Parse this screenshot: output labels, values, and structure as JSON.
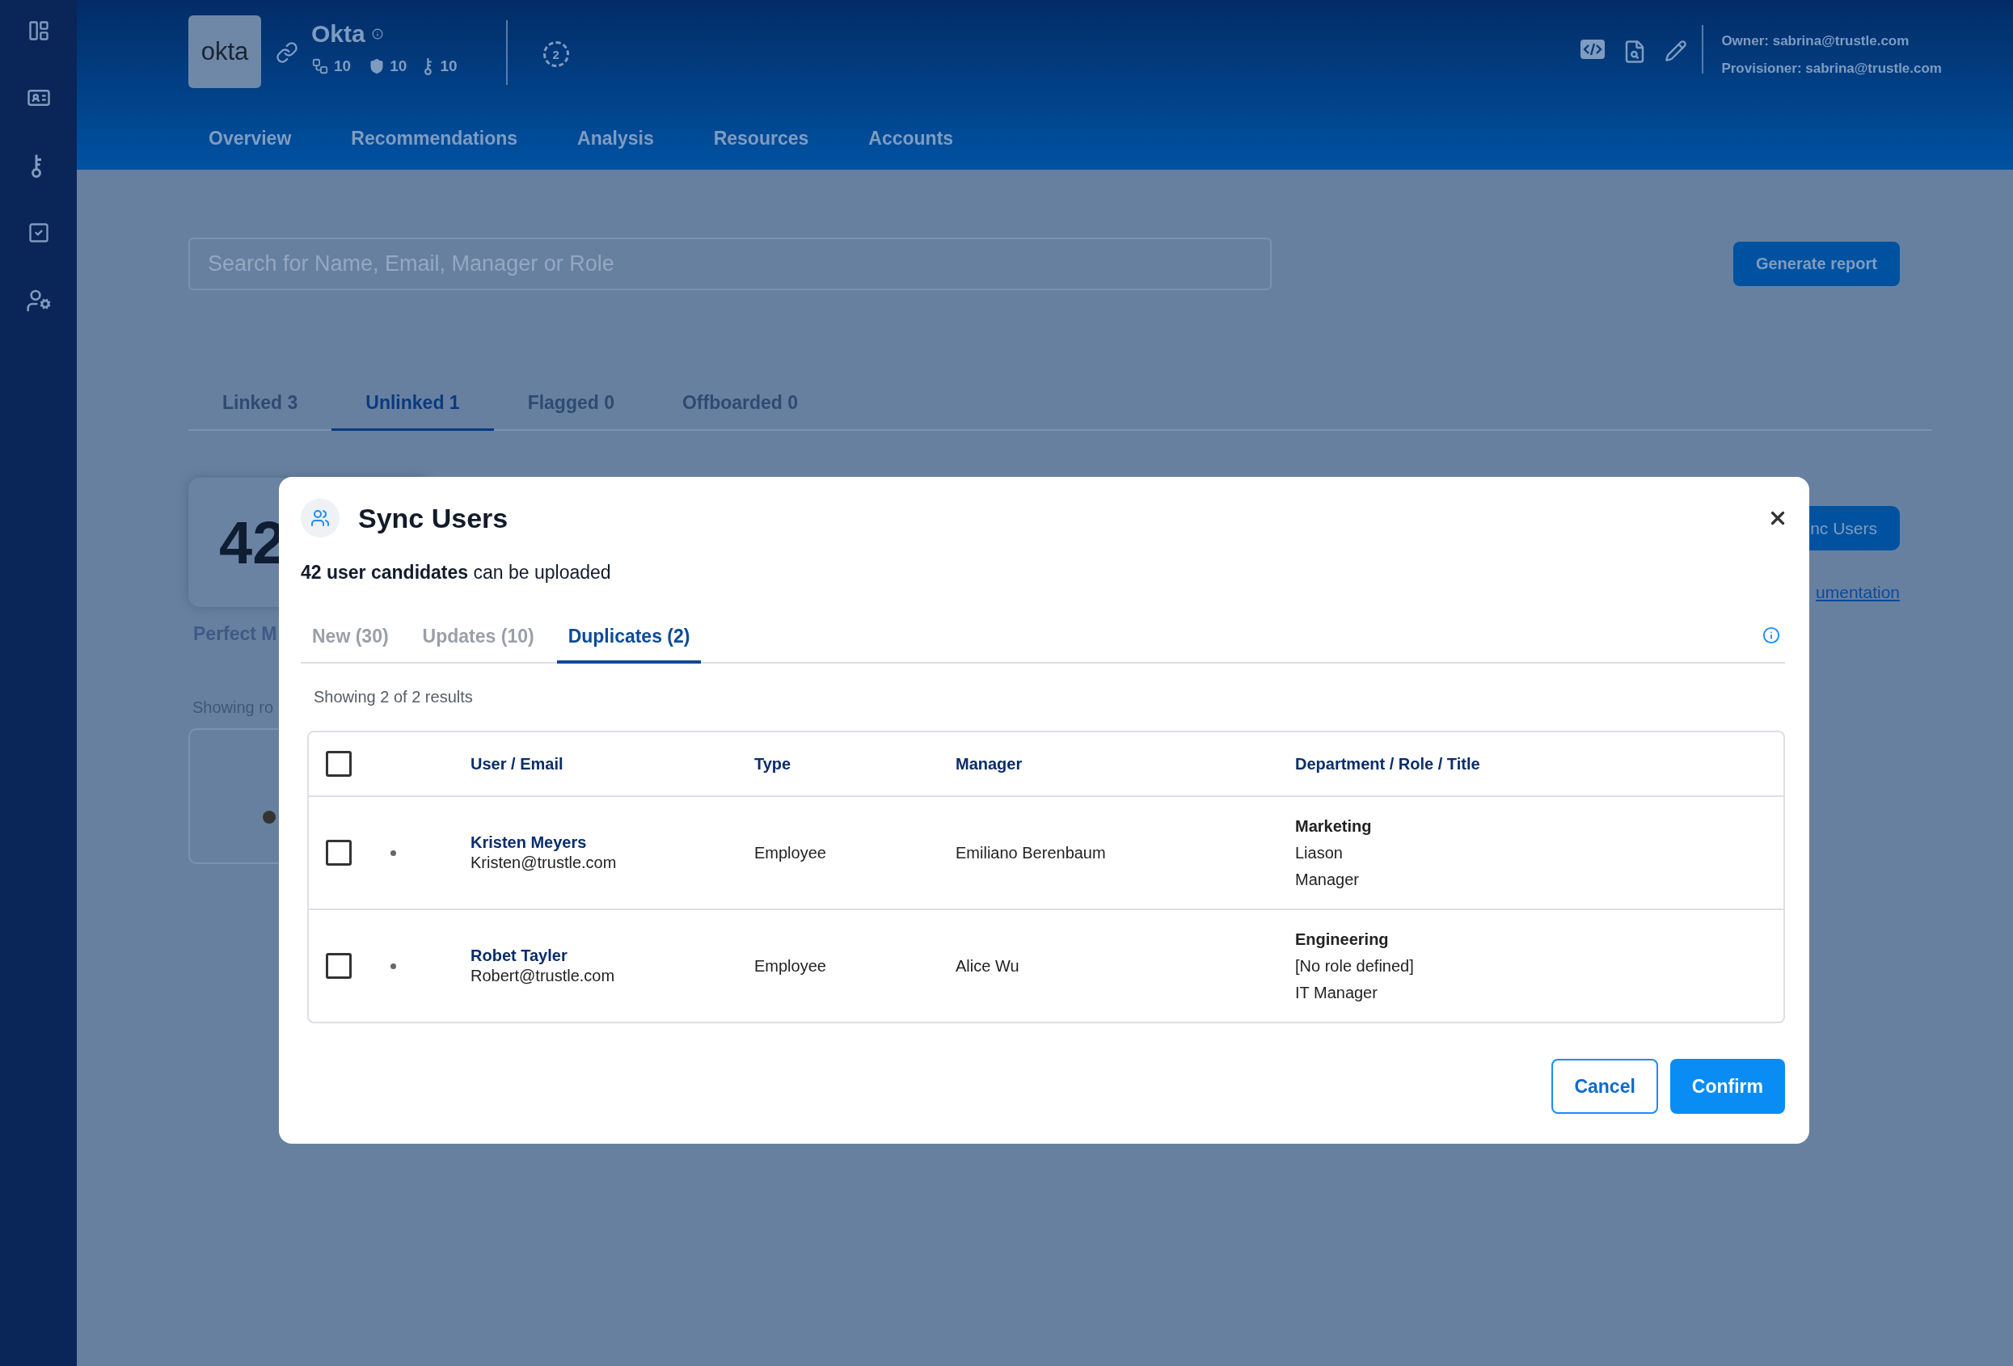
{
  "app": {
    "logo": "okta",
    "name": "Okta",
    "stats": [
      "10",
      "10",
      "10"
    ],
    "badge": "2",
    "owner": "Owner: sabrina@trustle.com",
    "provisioner": "Provisioner: sabrina@trustle.com"
  },
  "nav": [
    "Overview",
    "Recommendations",
    "Analysis",
    "Resources",
    "Accounts"
  ],
  "search": {
    "placeholder": "Search for Name, Email, Manager or Role"
  },
  "generate_button": "Generate report",
  "tabs": [
    {
      "label": "Linked 3",
      "selected": false
    },
    {
      "label": "Unlinked 1",
      "selected": true
    },
    {
      "label": "Flagged 0",
      "selected": false
    },
    {
      "label": "Offboarded 0",
      "selected": false
    }
  ],
  "background": {
    "count": "42",
    "caption": "Perfect M",
    "showing": "Showing ro",
    "sync_button": "nc Users",
    "doc_link": "umentation"
  },
  "modal": {
    "title": "Sync Users",
    "subtitle": "**42 user candidates** can be uploaded",
    "tabs": [
      {
        "label": "New (30)",
        "selected": false
      },
      {
        "label": "Updates (10)",
        "selected": false
      },
      {
        "label": "Duplicates (2)",
        "selected": true
      }
    ],
    "results": "Showing 2 of 2 results",
    "table": {
      "select_all": {
        "checked": false
      },
      "columns": [
        "User / Email",
        "Type",
        "Manager",
        "Department / Role / Title"
      ],
      "rows": [
        {
          "checked": false,
          "name": "Kristen Meyers",
          "email": "Kristen@trustle.com",
          "type": "Employee",
          "manager": "Emiliano Berenbaum",
          "department": "Marketing",
          "role": "Liason",
          "title": "Manager"
        },
        {
          "checked": false,
          "name": "Robet Tayler",
          "email": "Robert@trustle.com",
          "type": "Employee",
          "manager": "Alice Wu",
          "department": "Engineering",
          "role": "[No role defined]",
          "title": "IT Manager"
        }
      ]
    },
    "buttons": {
      "cancel": "Cancel",
      "confirm": "Confirm"
    }
  }
}
